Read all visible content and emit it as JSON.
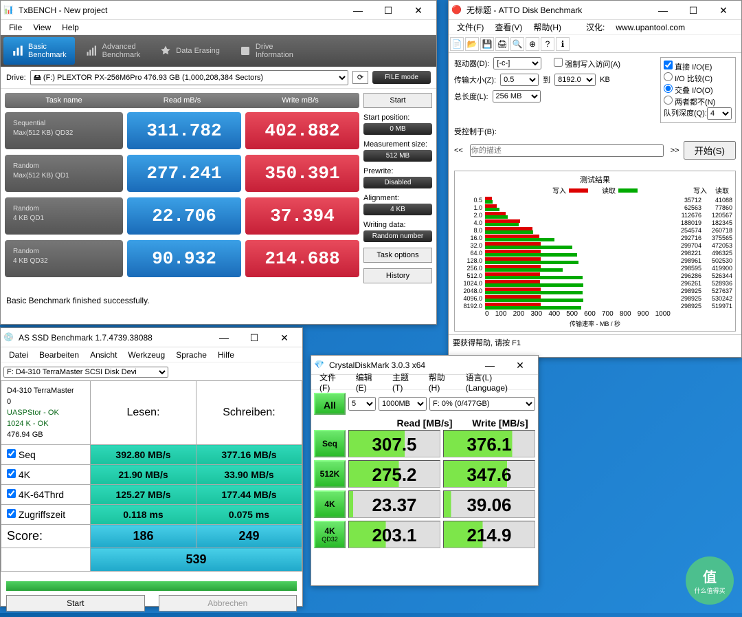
{
  "txbench": {
    "title": "TxBENCH - New project",
    "menu": [
      "File",
      "View",
      "Help"
    ],
    "tabs": [
      {
        "label": "Basic\nBenchmark"
      },
      {
        "label": "Advanced\nBenchmark"
      },
      {
        "label": "Data Erasing"
      },
      {
        "label": "Drive\nInformation"
      }
    ],
    "drive_label": "Drive:",
    "drive_value": "🖴 (F:) PLEXTOR PX-256M6Pro   476.93 GB (1,000,208,384 Sectors)",
    "file_mode": "FILE mode",
    "headers": [
      "Task name",
      "Read mB/s",
      "Write mB/s"
    ],
    "rows": [
      {
        "label1": "Sequential",
        "label2": "Max(512 KB) QD32",
        "read": "311.782",
        "write": "402.882"
      },
      {
        "label1": "Random",
        "label2": "Max(512 KB) QD1",
        "read": "277.241",
        "write": "350.391"
      },
      {
        "label1": "Random",
        "label2": "4 KB QD1",
        "read": "22.706",
        "write": "37.394"
      },
      {
        "label1": "Random",
        "label2": "4 KB QD32",
        "read": "90.932",
        "write": "214.688"
      }
    ],
    "side": {
      "start": "Start",
      "start_pos_label": "Start position:",
      "start_pos": "0 MB",
      "meas_size_label": "Measurement size:",
      "meas_size": "512 MB",
      "prewrite_label": "Prewrite:",
      "prewrite": "Disabled",
      "alignment_label": "Alignment:",
      "alignment": "4 KB",
      "writing_label": "Writing data:",
      "writing": "Random number",
      "task_options": "Task options",
      "history": "History"
    },
    "status": "Basic Benchmark finished successfully."
  },
  "atto": {
    "title": "无标题 - ATTO Disk Benchmark",
    "menu": [
      "文件(F)",
      "查看(V)",
      "帮助(H)"
    ],
    "hanhua_label": "汉化:",
    "hanhua_link": "www.upantool.com",
    "labels": {
      "drive": "驱动器(D):",
      "drive_val": "[-c-]",
      "force_write": "强制写入访问(A)",
      "direct_io": "直接 I/O(E)",
      "io_compare": "I/O 比较(C)",
      "overlap": "交叠 I/O(O)",
      "neither": "两者都不(N)",
      "transfer": "传输大小(Z):",
      "transfer_from": "0.5",
      "to": "到",
      "transfer_to": "8192.0",
      "kb": "KB",
      "total_len": "总长度(L):",
      "total_len_val": "256 MB",
      "queue_depth": "队列深度(Q):",
      "queue_depth_val": "4",
      "controlled": "受控制于(B):",
      "desc": "你的描述",
      "start": "开始(S)",
      "result_title": "测试结果",
      "write": "写入",
      "read": "读取",
      "axis_label": "传输速率 - MB / 秒",
      "status": "要获得帮助, 请按 F1"
    },
    "chart_data": {
      "type": "bar",
      "xlabel": "传输速率 - MB / 秒",
      "xlim": [
        0,
        1000
      ],
      "xticks": [
        0,
        100,
        200,
        300,
        400,
        500,
        600,
        700,
        800,
        900,
        1000
      ],
      "categories": [
        "0.5",
        "1.0",
        "2.0",
        "4.0",
        "8.0",
        "16.0",
        "32.0",
        "64.0",
        "128.0",
        "256.0",
        "512.0",
        "1024.0",
        "2048.0",
        "4096.0",
        "8192.0"
      ],
      "series": [
        {
          "name": "写入",
          "color": "#d00000",
          "values": [
            35.712,
            62.563,
            112.676,
            188.019,
            254.574,
            292.716,
            299.704,
            298.221,
            298.961,
            298.595,
            296.286,
            296.261,
            298.925,
            298.925,
            298.925
          ]
        },
        {
          "name": "读取",
          "color": "#00a000",
          "values": [
            41.088,
            77.86,
            120.567,
            182.345,
            260.718,
            375.565,
            472.053,
            496.325,
            502.53,
            419.9,
            526.344,
            528.936,
            527.637,
            530.242,
            519.971
          ]
        }
      ],
      "table": [
        {
          "size": "0.5",
          "write": "35712",
          "read": "41088"
        },
        {
          "size": "1.0",
          "write": "62563",
          "read": "77860"
        },
        {
          "size": "2.0",
          "write": "112676",
          "read": "120567"
        },
        {
          "size": "4.0",
          "write": "188019",
          "read": "182345"
        },
        {
          "size": "8.0",
          "write": "254574",
          "read": "260718"
        },
        {
          "size": "16.0",
          "write": "292716",
          "read": "375565"
        },
        {
          "size": "32.0",
          "write": "299704",
          "read": "472053"
        },
        {
          "size": "64.0",
          "write": "298221",
          "read": "496325"
        },
        {
          "size": "128.0",
          "write": "298961",
          "read": "502530"
        },
        {
          "size": "256.0",
          "write": "298595",
          "read": "419900"
        },
        {
          "size": "512.0",
          "write": "296286",
          "read": "526344"
        },
        {
          "size": "1024.0",
          "write": "296261",
          "read": "528936"
        },
        {
          "size": "2048.0",
          "write": "298925",
          "read": "527637"
        },
        {
          "size": "4096.0",
          "write": "298925",
          "read": "530242"
        },
        {
          "size": "8192.0",
          "write": "298925",
          "read": "519971"
        }
      ]
    }
  },
  "assd": {
    "title": "AS SSD Benchmark 1.7.4739.38088",
    "menu": [
      "Datei",
      "Bearbeiten",
      "Ansicht",
      "Werkzeug",
      "Sprache",
      "Hilfe"
    ],
    "drive_select": "F: D4-310 TerraMaster SCSI Disk Devi",
    "info": [
      "D4-310 TerraMaster",
      "0",
      "UASPStor - OK",
      "1024 K - OK",
      "476.94 GB"
    ],
    "lesen": "Lesen:",
    "schreiben": "Schreiben:",
    "rows": [
      {
        "label": "Seq",
        "read": "392.80 MB/s",
        "write": "377.16 MB/s"
      },
      {
        "label": "4K",
        "read": "21.90 MB/s",
        "write": "33.90 MB/s"
      },
      {
        "label": "4K-64Thrd",
        "read": "125.27 MB/s",
        "write": "177.44 MB/s"
      },
      {
        "label": "Zugriffszeit",
        "read": "0.118 ms",
        "write": "0.075 ms"
      }
    ],
    "score_label": "Score:",
    "score_read": "186",
    "score_write": "249",
    "score_total": "539",
    "start": "Start",
    "abort": "Abbrechen"
  },
  "cdm": {
    "title": "CrystalDiskMark 3.0.3 x64",
    "menu": [
      "文件(F)",
      "编辑(E)",
      "主题(T)",
      "帮助(H)",
      "语言(L)(Language)"
    ],
    "all": "All",
    "runs": "5",
    "size": "1000MB",
    "drive": "F: 0% (0/477GB)",
    "read_hdr": "Read [MB/s]",
    "write_hdr": "Write [MB/s]",
    "rows": [
      {
        "btn": "Seq",
        "sub": "",
        "read": "307.5",
        "write": "376.1"
      },
      {
        "btn": "512K",
        "sub": "",
        "read": "275.2",
        "write": "347.6"
      },
      {
        "btn": "4K",
        "sub": "",
        "read": "23.37",
        "write": "39.06"
      },
      {
        "btn": "4K",
        "sub": "QD32",
        "read": "203.1",
        "write": "214.9"
      }
    ]
  },
  "smzdm": {
    "logo": "值",
    "sub": "什么值得买"
  }
}
